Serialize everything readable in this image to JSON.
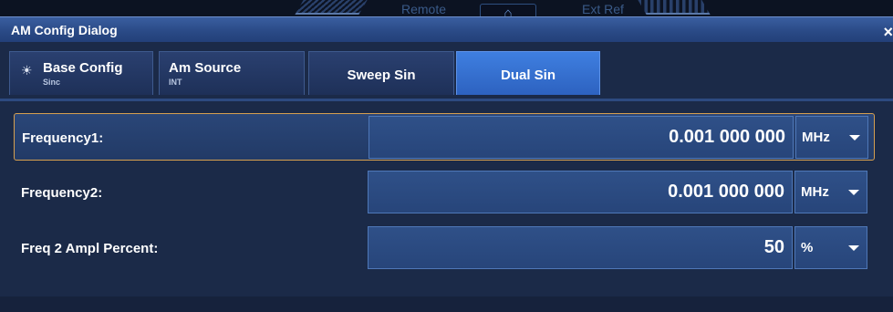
{
  "topbar": {
    "remote_label": "Remote",
    "extref_label": "Ext Ref",
    "home_icon": "home-icon"
  },
  "dialog": {
    "title": "AM Config Dialog",
    "close_glyph": "×"
  },
  "tabs": [
    {
      "label": "Base Config",
      "sublabel": "Sinc",
      "icon": "sun-icon"
    },
    {
      "label": "Am Source",
      "sublabel": "INT"
    },
    {
      "label": "Sweep Sin",
      "sublabel": ""
    },
    {
      "label": "Dual Sin",
      "sublabel": "",
      "active": true
    }
  ],
  "rows": [
    {
      "label": "Frequency1:",
      "value": "0.001 000 000",
      "unit": "MHz",
      "selected": true
    },
    {
      "label": "Frequency2:",
      "value": "0.001 000 000",
      "unit": "MHz"
    },
    {
      "label": "Freq 2 Ampl Percent:",
      "value": "50",
      "unit": "%"
    }
  ],
  "colors": {
    "background": "#1b2a48",
    "active_tab": "#3f7fe0",
    "selected_border": "#d6a050"
  }
}
